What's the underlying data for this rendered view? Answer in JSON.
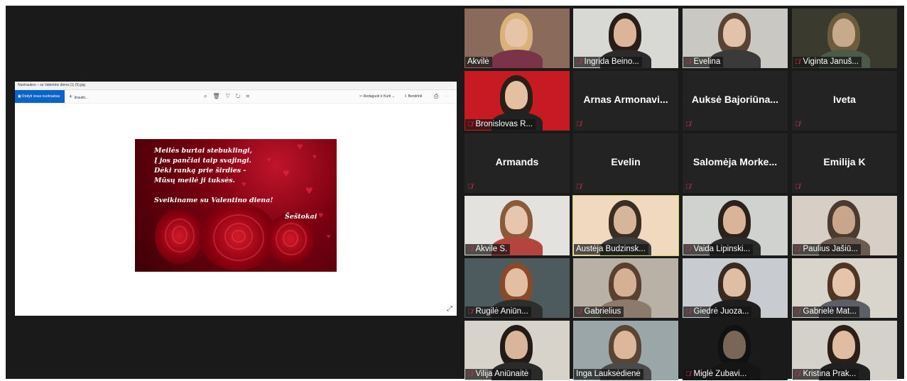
{
  "shared_window": {
    "title": "Nuotraukos – su Valentino diena (1) (5).jpg",
    "view_all_label": "Rodyti visas nuotraukas",
    "add_label": "Įtraukti...",
    "edit_label": "Redaguoti ir Kurti",
    "share_label": "Bendrinti",
    "card": {
      "poem_lines": [
        "Meilės burtai stebuklingi,",
        "Į jos pančiai taip svajingi.",
        "Dėki ranką prie širdies -",
        "Mūsų meilė ji tuksės."
      ],
      "greeting": "Sveikiname su Valentino diena!",
      "signature": "Šeštokai"
    }
  },
  "participants": [
    {
      "name": "Akvilė",
      "muted": false,
      "video": true,
      "bg": "#8a6a5a",
      "skin": "#e7c3a8",
      "hair": "#d9b27a",
      "shirt": "#7a3348"
    },
    {
      "name": "Ingrida Beino...",
      "muted": true,
      "video": true,
      "bg": "#d8d8d4",
      "skin": "#dcb49a",
      "hair": "#2a1d17",
      "shirt": "#2b2b2b"
    },
    {
      "name": "Evelina",
      "muted": true,
      "video": true,
      "bg": "#c9c8c2",
      "skin": "#e2c2aa",
      "hair": "#5a4334",
      "shirt": "#3a3a3a"
    },
    {
      "name": "Viginta Januš...",
      "muted": true,
      "video": true,
      "bg": "#3b3a2e",
      "skin": "#c7a98b",
      "hair": "#6d5b3e",
      "shirt": "#4d5a4a"
    },
    {
      "name": "Bronislovas R...",
      "muted": true,
      "video": true,
      "bg": "#c81a22",
      "skin": "#e5c0a0",
      "hair": "#2a1e18",
      "shirt": "#222222"
    },
    {
      "name": "Arnas Armonavi...",
      "muted": true,
      "video": false
    },
    {
      "name": "Auksė Bajoriūna...",
      "muted": true,
      "video": false
    },
    {
      "name": "Iveta",
      "muted": true,
      "video": false
    },
    {
      "name": "Armands",
      "muted": true,
      "video": false
    },
    {
      "name": "Evelin",
      "muted": true,
      "video": false
    },
    {
      "name": "Salomėja Morke...",
      "muted": true,
      "video": false
    },
    {
      "name": "Emilija K",
      "muted": true,
      "video": false
    },
    {
      "name": "Akvile S.",
      "muted": true,
      "video": true,
      "bg": "#e4e2de",
      "skin": "#e8c5ae",
      "hair": "#8a5b3a",
      "shirt": "#b5443c"
    },
    {
      "name": "Austėja Budzinsk...",
      "muted": false,
      "video": true,
      "active": true,
      "bg": "#f1d9c0",
      "skin": "#d8b499",
      "hair": "#3a2d24",
      "shirt": "#3d3d3d"
    },
    {
      "name": "Vaida Lipinski...",
      "muted": true,
      "video": true,
      "bg": "#cfd2cf",
      "skin": "#d9b39a",
      "hair": "#2c211b",
      "shirt": "#2a2a2a"
    },
    {
      "name": "Paulius Jašiū...",
      "muted": true,
      "video": true,
      "bg": "#d7cfc6",
      "skin": "#c9a58c",
      "hair": "#4a3a30",
      "shirt": "#6a5a50"
    },
    {
      "name": "Rugilė Aniūn...",
      "muted": true,
      "video": true,
      "bg": "#4e5b5e",
      "skin": "#e4bea3",
      "hair": "#8a4a2a",
      "shirt": "#2e2e2e"
    },
    {
      "name": "Gabrielius",
      "muted": true,
      "video": true,
      "bg": "#b9b0a6",
      "skin": "#d5b095",
      "hair": "#5a4030",
      "shirt": "#8c7a6c"
    },
    {
      "name": "Giedrė Juoza...",
      "muted": true,
      "video": true,
      "bg": "#c8ccd0",
      "skin": "#e0bea6",
      "hair": "#3a2a20",
      "shirt": "#1e1e1e"
    },
    {
      "name": "Gabrielė Mat...",
      "muted": true,
      "video": true,
      "bg": "#d9d4cc",
      "skin": "#e6c4ab",
      "hair": "#4e3526",
      "shirt": "#5d5f66"
    },
    {
      "name": "Vilija Aniūnaitė",
      "muted": true,
      "video": true,
      "bg": "#d7d2ca",
      "skin": "#d9b59b",
      "hair": "#251b16",
      "shirt": "#2a2a2a"
    },
    {
      "name": "Inga Lauksėdienė",
      "muted": false,
      "video": true,
      "bg": "#9aa6a8",
      "skin": "#dcb79c",
      "hair": "#5a4434",
      "shirt": "#4a4a4a"
    },
    {
      "name": "Miglė Zubavi...",
      "muted": true,
      "video": true,
      "bg": "#1a1a1a",
      "skin": "#7a6656",
      "hair": "#111111",
      "shirt": "#151515"
    },
    {
      "name": "Kristina Prak...",
      "muted": true,
      "video": true,
      "bg": "#d4d0ca",
      "skin": "#dfbca2",
      "hair": "#2b1f18",
      "shirt": "#202020"
    }
  ]
}
